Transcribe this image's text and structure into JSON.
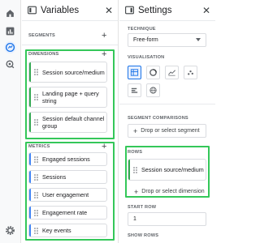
{
  "rail": {
    "icons": [
      "home-icon",
      "reports-icon",
      "explore-icon",
      "advertising-icon",
      "settings-icon"
    ]
  },
  "variables": {
    "title": "Variables",
    "close": "✕",
    "segments_label": "SEGMENTS",
    "dimensions_label": "DIMENSIONS",
    "dimensions": [
      "Session source/medium",
      "Landing page + query string",
      "Session default channel group"
    ],
    "metrics_label": "METRICS",
    "metrics": [
      "Engaged sessions",
      "Sessions",
      "User engagement",
      "Engagement rate",
      "Key events"
    ]
  },
  "settings": {
    "title": "Settings",
    "close": "✕",
    "technique_label": "TECHNIQUE",
    "technique_value": "Free-form",
    "visualisation_label": "VISUALISATION",
    "vis_options": [
      "table-icon",
      "donut-chart-icon",
      "line-chart-icon",
      "scatter-icon",
      "bar-chart-icon",
      "globe-icon"
    ],
    "segment_comparisons_label": "SEGMENT COMPARISONS",
    "drop_segment": "Drop or select segment",
    "rows_label": "ROWS",
    "rows_item": "Session source/medium",
    "drop_dimension": "Drop or select dimension",
    "start_row_label": "START ROW",
    "start_row_value": "1",
    "show_rows_label": "SHOW ROWS"
  },
  "colors": {
    "highlight": "#34c759",
    "dimension_bar": "#34a853",
    "metric_bar": "#4285f4",
    "accent": "#1a73e8"
  }
}
